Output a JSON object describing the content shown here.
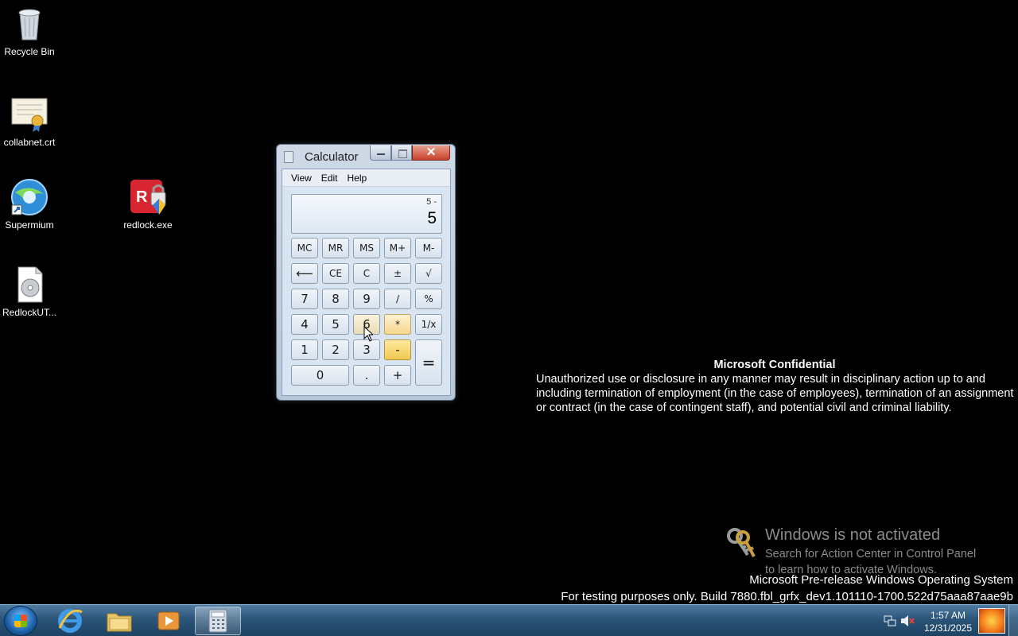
{
  "desktop": {
    "icons": [
      {
        "label": "Recycle Bin",
        "icon": "recycle-bin-icon"
      },
      {
        "label": "collabnet.crt",
        "icon": "certificate-icon"
      },
      {
        "label": "Supermium",
        "icon": "browser-icon"
      },
      {
        "label": "redlock.exe",
        "icon": "redlock-app-icon"
      },
      {
        "label": "RedlockUT...",
        "icon": "disc-image-icon"
      }
    ]
  },
  "calculator": {
    "title": "Calculator",
    "menu": [
      "View",
      "Edit",
      "Help"
    ],
    "display": {
      "expression": "5 -",
      "value": "5"
    },
    "keys": {
      "mc": "MC",
      "mr": "MR",
      "ms": "MS",
      "mplus": "M+",
      "mminus": "M-",
      "back": "⟵",
      "ce": "CE",
      "c": "C",
      "plusminus": "±",
      "sqrt": "√",
      "k7": "7",
      "k8": "8",
      "k9": "9",
      "div": "/",
      "pct": "%",
      "k4": "4",
      "k5": "5",
      "k6": "6",
      "mul": "*",
      "recip": "1/x",
      "k1": "1",
      "k2": "2",
      "k3": "3",
      "sub": "-",
      "eq": "=",
      "k0": "0",
      "dot": ".",
      "add": "+"
    },
    "close_glyph": "✕"
  },
  "notice": {
    "heading": "Microsoft Confidential",
    "body": "Unauthorized use or disclosure in any manner may result in disciplinary action up to and including termination of employment (in the case of employees), termination of an assignment or contract (in the case of contingent staff), and potential civil and criminal liability."
  },
  "activation": {
    "title": "Windows is not activated",
    "line1": "Search for Action Center in Control Panel",
    "line2": "to learn how to activate Windows."
  },
  "build": {
    "line1": "Microsoft Pre-release Windows Operating System",
    "line2": "For testing purposes only. Build 7880.fbl_grfx_dev1.101110-1700.522d75aaa87aae9b"
  },
  "taskbar": {
    "pinned": [
      "internet-explorer-icon",
      "file-explorer-icon",
      "media-player-icon",
      "calculator-icon"
    ],
    "clock": {
      "time": "1:57 AM",
      "date": "12/31/2025"
    }
  }
}
